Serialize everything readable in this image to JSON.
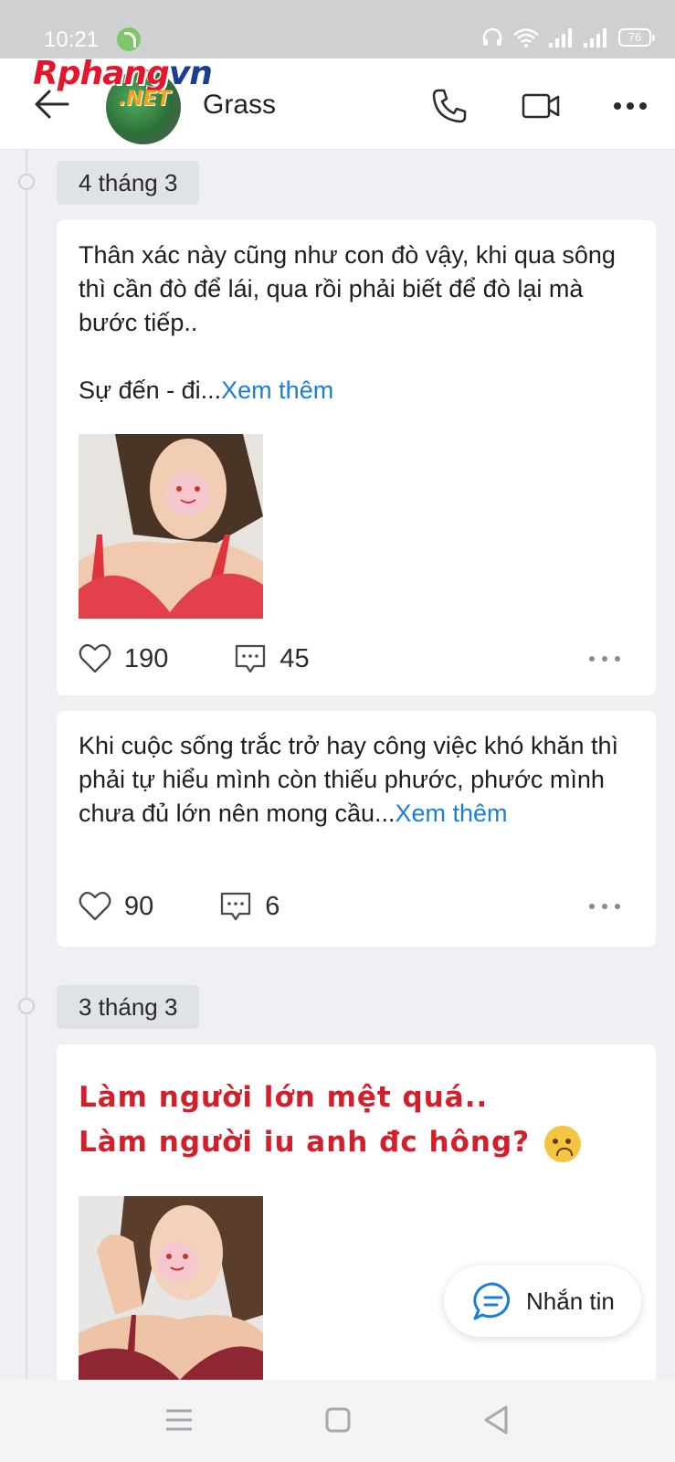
{
  "status_bar": {
    "time": "10:21",
    "battery": "76",
    "icons": [
      "app-notification-icon",
      "headset-icon",
      "wifi-icon",
      "signal-icon",
      "signal-icon",
      "battery-icon"
    ]
  },
  "watermark": {
    "text_red": "Rphang",
    "text_blue": "vn",
    "text_sub": ".NET"
  },
  "header": {
    "contact_name": "Grass",
    "icons": [
      "back-arrow-icon",
      "phone-icon",
      "video-camera-icon",
      "more-dots-icon"
    ]
  },
  "timeline": [
    {
      "date": "4 tháng 3",
      "posts": [
        {
          "text": "Thân xác này cũng như con đò vậy, khi qua sông thì cần đò để lái, qua rồi phải biết để đò lại mà bước tiếp..\n\nSự đến - đi...",
          "see_more": "Xem thêm",
          "likes": "190",
          "comments": "45",
          "has_photo": true
        },
        {
          "text": "Khi cuộc sống trắc trở hay công việc khó khăn thì phải tự hiểu mình còn thiếu phước, phước mình chưa đủ lớn nên mong cầu...",
          "see_more": "Xem thêm",
          "likes": "90",
          "comments": "6",
          "has_photo": false
        }
      ]
    },
    {
      "date": "3 tháng 3",
      "posts": [
        {
          "styled_line_1": "Làm người lớn mệt quá..",
          "styled_line_2": "Làm người iu anh đc hông?",
          "has_photo": true
        }
      ]
    }
  ],
  "message_button": {
    "label": "Nhắn tin"
  },
  "colors": {
    "link": "#1a7fd6",
    "styled_text": "#d21f2c",
    "background": "#eef0f3",
    "card": "#ffffff",
    "date_pill": "#dfe2e6"
  },
  "nav_bar": {
    "icons": [
      "menu-icon",
      "home-square-icon",
      "back-triangle-icon"
    ]
  }
}
